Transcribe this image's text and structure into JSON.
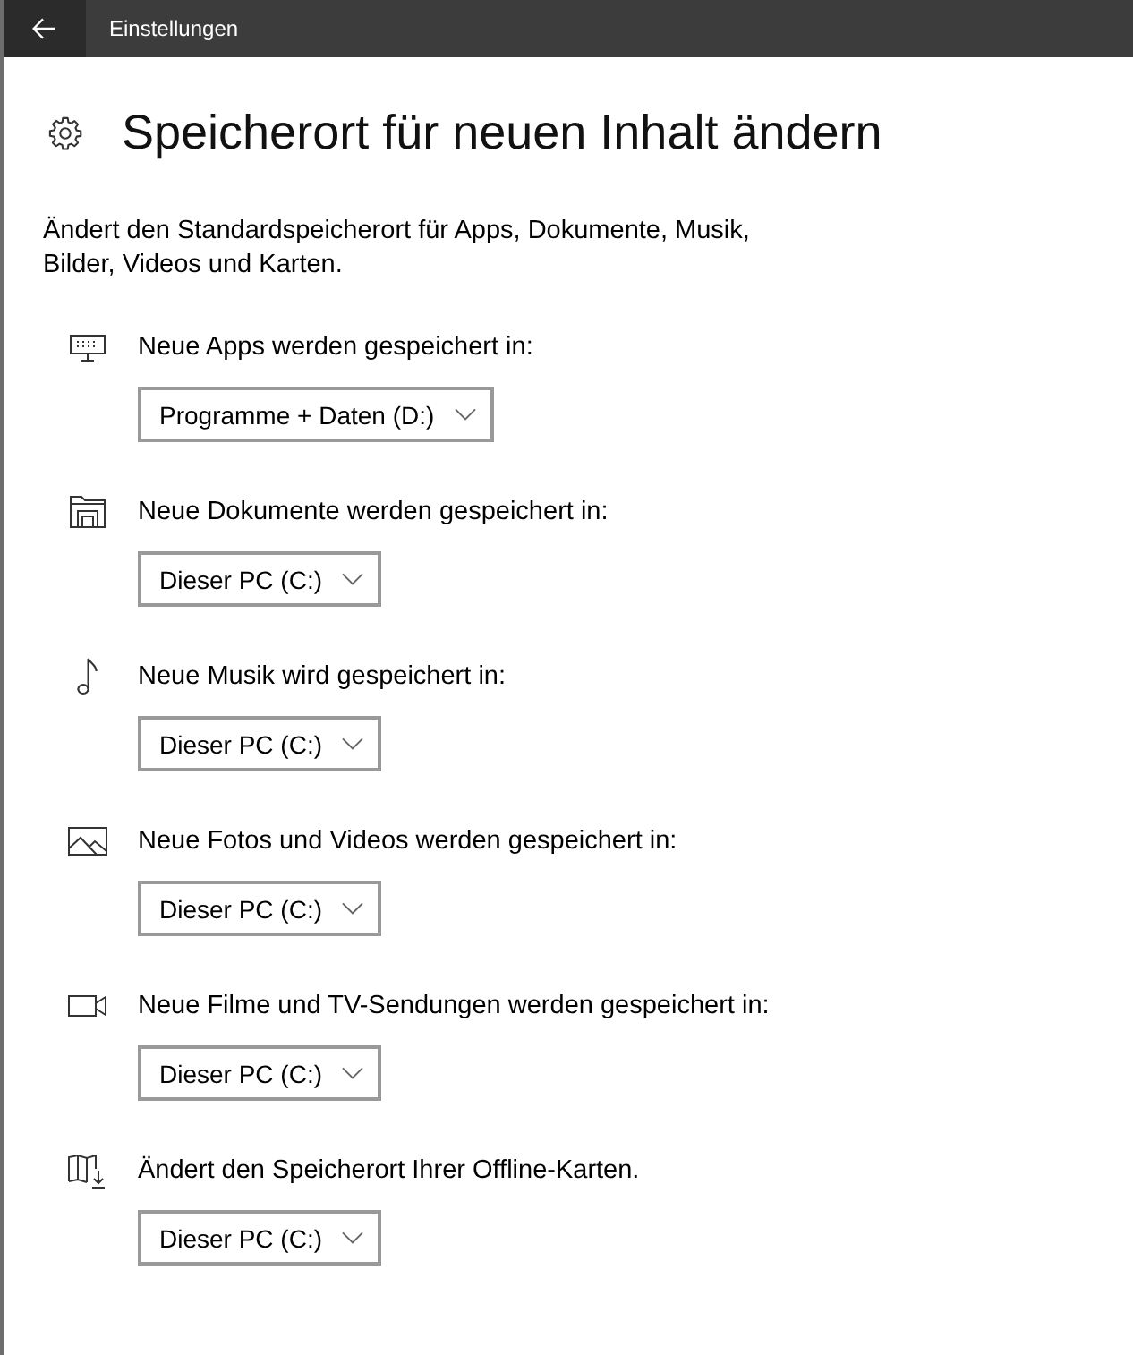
{
  "window": {
    "title": "Einstellungen"
  },
  "page": {
    "title": "Speicherort für neuen Inhalt ändern",
    "description": "Ändert den Standardspeicherort für Apps, Dokumente, Musik,\nBilder, Videos und Karten."
  },
  "sections": [
    {
      "kind": "apps",
      "label": "Neue Apps werden gespeichert in:",
      "value": "Programme + Daten (D:)"
    },
    {
      "kind": "documents",
      "label": "Neue Dokumente werden gespeichert in:",
      "value": "Dieser PC (C:)"
    },
    {
      "kind": "music",
      "label": "Neue Musik wird gespeichert in:",
      "value": "Dieser PC (C:)"
    },
    {
      "kind": "photos",
      "label": "Neue Fotos und Videos werden gespeichert in:",
      "value": "Dieser PC (C:)"
    },
    {
      "kind": "videos",
      "label": "Neue Filme und TV-Sendungen werden gespeichert in:",
      "value": "Dieser PC (C:)"
    },
    {
      "kind": "maps",
      "label": "Ändert den Speicherort Ihrer Offline-Karten.",
      "value": "Dieser PC (C:)"
    }
  ]
}
